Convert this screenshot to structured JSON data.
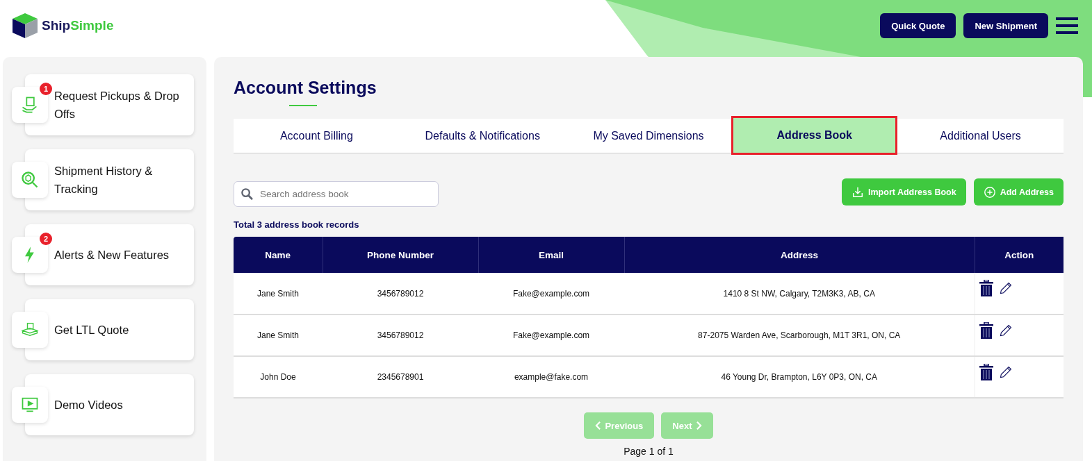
{
  "header": {
    "logo": {
      "primary": "Ship",
      "secondary": "Simple"
    },
    "buttons": [
      "Quick Quote",
      "New Shipment"
    ]
  },
  "sidebar": {
    "items": [
      {
        "label": "Request Pickups & Drop Offs",
        "kind": "pickup",
        "badge": "1"
      },
      {
        "label": "Shipment History & Tracking",
        "kind": "tracking"
      },
      {
        "label": "Alerts & New Features",
        "kind": "alert",
        "badge": "2"
      },
      {
        "label": "Get LTL Quote",
        "kind": "ltl"
      },
      {
        "label": "Demo Videos",
        "kind": "video"
      }
    ]
  },
  "page": {
    "title": "Account Settings",
    "tabs": [
      {
        "label": "Account Billing",
        "selected": false
      },
      {
        "label": "Defaults & Notifications",
        "selected": false
      },
      {
        "label": "My Saved Dimensions",
        "selected": false
      },
      {
        "label": "Address Book",
        "selected": true
      },
      {
        "label": "Additional Users",
        "selected": false
      }
    ],
    "search": {
      "placeholder": "Search address book"
    },
    "actions": [
      {
        "label": "Import Address Book",
        "kind": "import"
      },
      {
        "label": "Add Address",
        "kind": "add"
      }
    ],
    "total": "Total 3 address book records",
    "table": {
      "columns": [
        "Name",
        "Phone Number",
        "Email",
        "Address",
        "Action"
      ],
      "rows": [
        {
          "name": "Jane Smith",
          "phone": "3456789012",
          "email": "Fake@example.com",
          "address": "1410 8 St NW, Calgary, T2M3K3, AB, CA"
        },
        {
          "name": "Jane Smith",
          "phone": "3456789012",
          "email": "Fake@example.com",
          "address": "87-2075 Warden Ave, Scarborough, M1T 3R1, ON, CA"
        },
        {
          "name": "John Doe",
          "phone": "2345678901",
          "email": "example@fake.com",
          "address": "46 Young Dr, Brampton, L6Y 0P3, ON, CA"
        }
      ]
    },
    "pagination": {
      "previous": {
        "label": "Previous",
        "disabled": true
      },
      "next": {
        "label": "Next",
        "disabled": true
      },
      "status": "Page 1 of 1"
    }
  }
}
